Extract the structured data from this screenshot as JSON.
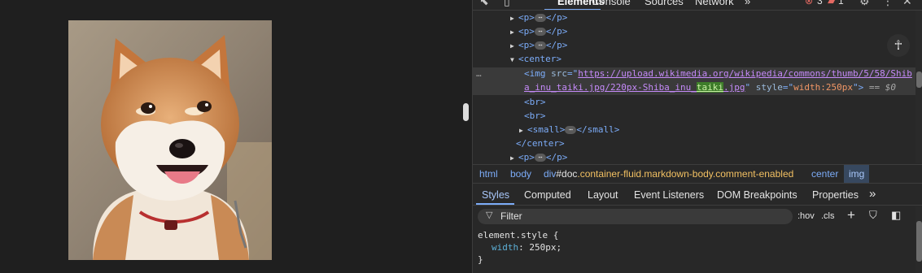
{
  "toolbar": {
    "tabs": [
      "Elements",
      "Console",
      "Sources",
      "Network"
    ],
    "more_tabs": "»",
    "error_count": "3",
    "warning_count": "1"
  },
  "dom": {
    "p_tag_open": "<p>",
    "p_tag_close": "</p>",
    "ellipsis": "⋯",
    "center_open": "<center>",
    "img_open": "<img",
    "src_attr": "src",
    "src_value_1": "https://upload.wikimedia.org/wikipedia/commons/thumb/5/58/Shib",
    "src_value_2": "a_inu_taiki.jpg/220px-Shiba_inu_",
    "src_value_hl": "taiki",
    "src_value_3": ".jpg",
    "style_attr": "style",
    "style_value": "width:250px",
    "img_close": ">",
    "eq_var": "== $0",
    "br": "<br>",
    "small_open": "<small>",
    "small_close": "</small>",
    "center_close": "</center>",
    "row_dots": "…"
  },
  "breadcrumb": {
    "items": [
      "html",
      "body"
    ],
    "div_tag": "div",
    "div_id": "#doc",
    "div_classes": ".container-fluid.markdown-body.comment-enabled",
    "center": "center",
    "img": "img"
  },
  "style_tabs": [
    "Styles",
    "Computed",
    "Layout",
    "Event Listeners",
    "DOM Breakpoints",
    "Properties"
  ],
  "style_tabs_more": "»",
  "filter": {
    "placeholder": "Filter",
    "hov": ":hov",
    "cls": ".cls",
    "add": "+"
  },
  "styles": {
    "selector": "element.style {",
    "property": "width",
    "value": "250px;",
    "close": "}"
  },
  "colors": {
    "accent": "#7cacf8",
    "background": "#282828",
    "selected_row": "#3a3a3a"
  }
}
